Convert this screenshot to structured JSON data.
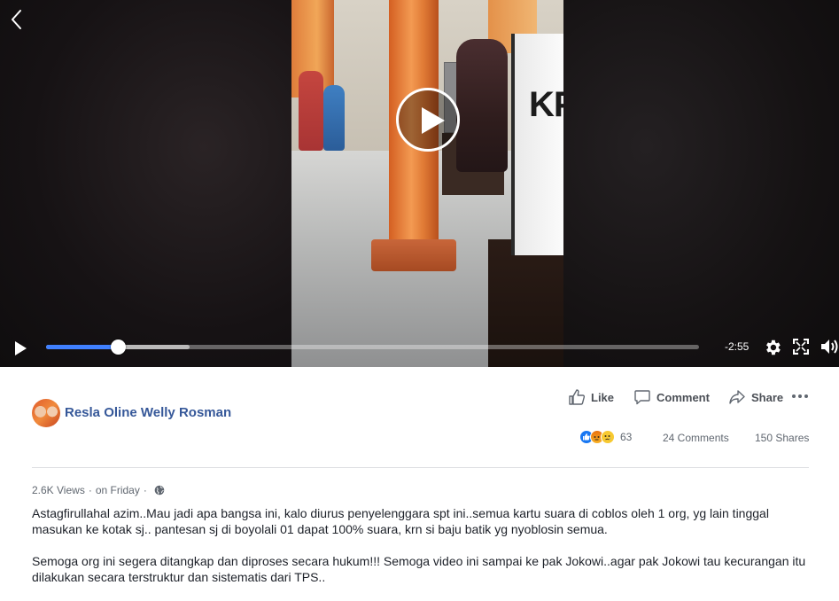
{
  "video": {
    "box_text": "KP",
    "time_remaining": "-2:55",
    "progress_played": 0.11,
    "progress_buffered": 0.22
  },
  "post": {
    "author": "Resla Oline Welly Rosman",
    "actions": {
      "like": "Like",
      "comment": "Comment",
      "share": "Share"
    },
    "reaction_count": "63",
    "comments": "24 Comments",
    "shares": "150 Shares",
    "views": "2.6K Views",
    "separator": "·",
    "time": "on Friday",
    "paragraphs": [
      "Astagfirullahal azim..Mau jadi apa bangsa ini, kalo diurus penyelenggara spt ini..semua kartu suara di coblos oleh 1 org, yg lain tinggal masukan ke kotak sj.. pantesan sj di boyolali 01 dapat 100% suara, krn si baju batik yg nyoblosin semua.",
      "Semoga org ini segera ditangkap dan diproses secara hukum!!! Semoga video ini sampai ke pak Jokowi..agar pak Jokowi tau kecurangan itu dilakukan secara terstruktur dan sistematis dari TPS.."
    ]
  },
  "icons": {
    "back": "chevron-left-icon",
    "play": "play-icon",
    "settings": "gear-icon",
    "fullscreen": "fullscreen-icon",
    "volume": "volume-icon",
    "like": "thumbs-up-icon",
    "comment": "comment-icon",
    "share": "share-icon",
    "more": "more-icon",
    "privacy": "globe-icon"
  },
  "colors": {
    "link": "#365899",
    "progress": "#4080ff",
    "like_reaction": "#1877f2"
  }
}
